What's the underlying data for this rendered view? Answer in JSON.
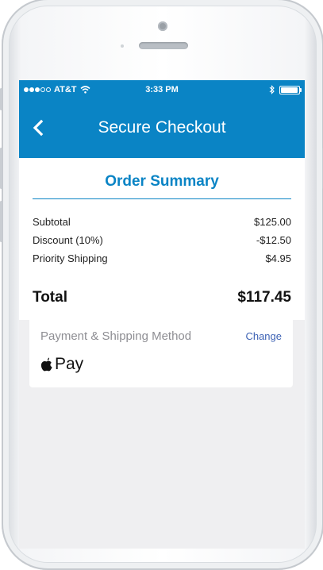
{
  "status_bar": {
    "carrier": "AT&T",
    "time": "3:33 PM",
    "icons": [
      "signal-icon",
      "wifi-icon",
      "bluetooth-icon",
      "battery-icon"
    ],
    "battery_level": 0.95
  },
  "nav": {
    "title": "Secure Checkout",
    "back_icon": "chevron-left-icon"
  },
  "order_summary": {
    "heading": "Order Summary",
    "lines": [
      {
        "label": "Subtotal",
        "amount": "$125.00"
      },
      {
        "label": "Discount (10%)",
        "amount": "-$12.50"
      },
      {
        "label": "Priority Shipping",
        "amount": "$4.95"
      }
    ],
    "total_label": "Total",
    "total_amount": "$117.45"
  },
  "payment": {
    "label": "Payment & Shipping Method",
    "change_label": "Change",
    "method": "Pay",
    "method_icon": "apple-logo-icon"
  },
  "colors": {
    "brand_blue": "#0a84c5",
    "link_blue": "#3e63b5",
    "background_gray": "#efeff1"
  }
}
